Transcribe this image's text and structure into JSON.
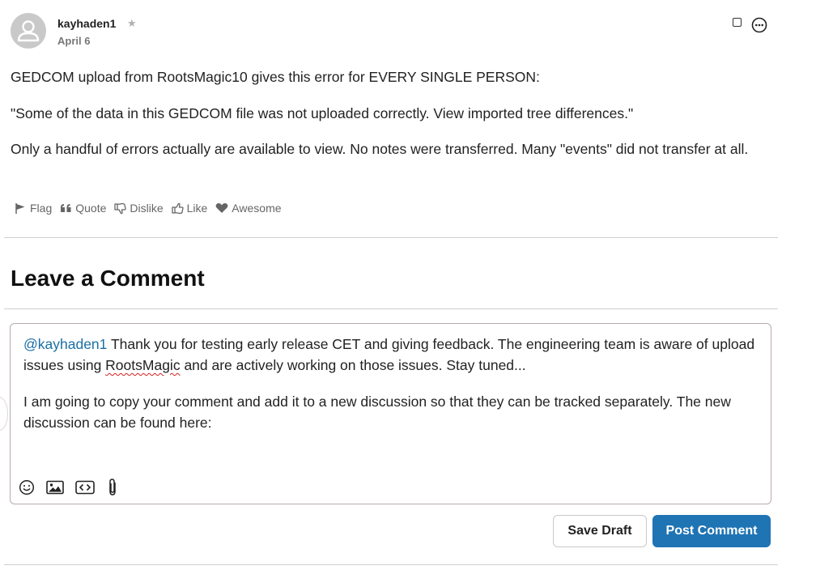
{
  "post": {
    "author": "kayhaden1",
    "role_icon": "star-icon",
    "date": "April 6",
    "paragraphs": [
      "GEDCOM upload from RootsMagic10 gives this error for EVERY SINGLE PERSON:",
      "\"Some of the data in this GEDCOM file was not uploaded correctly. View imported tree differences.\"",
      "Only a handful of errors actually are available to view. No notes were transferred. Many \"events\" did not transfer at all."
    ],
    "reactions": [
      {
        "label": "Flag",
        "icon": "flag-icon"
      },
      {
        "label": "Quote",
        "icon": "quote-icon"
      },
      {
        "label": "Dislike",
        "icon": "thumbs-down-icon"
      },
      {
        "label": "Like",
        "icon": "thumbs-up-icon"
      },
      {
        "label": "Awesome",
        "icon": "heart-icon"
      }
    ]
  },
  "comment": {
    "heading": "Leave a Comment",
    "mention": "@kayhaden1",
    "line1_a": " Thank you for testing early release CET and giving feedback.  The engineering team is aware of upload issues using ",
    "line1_misspelled": "RootsMagic",
    "line1_b": " and are actively working on those issues.  Stay tuned...",
    "line2": "I am going to copy your comment and add it to a new discussion so that they can be tracked separately.  The new discussion can be found here:",
    "toolbar": [
      "emoji-icon",
      "image-icon",
      "code-icon",
      "attachment-icon"
    ],
    "save_draft_label": "Save Draft",
    "post_label": "Post Comment"
  },
  "colors": {
    "accent": "#1f74b4",
    "mention": "#1a6fa5",
    "muted": "#666666"
  }
}
